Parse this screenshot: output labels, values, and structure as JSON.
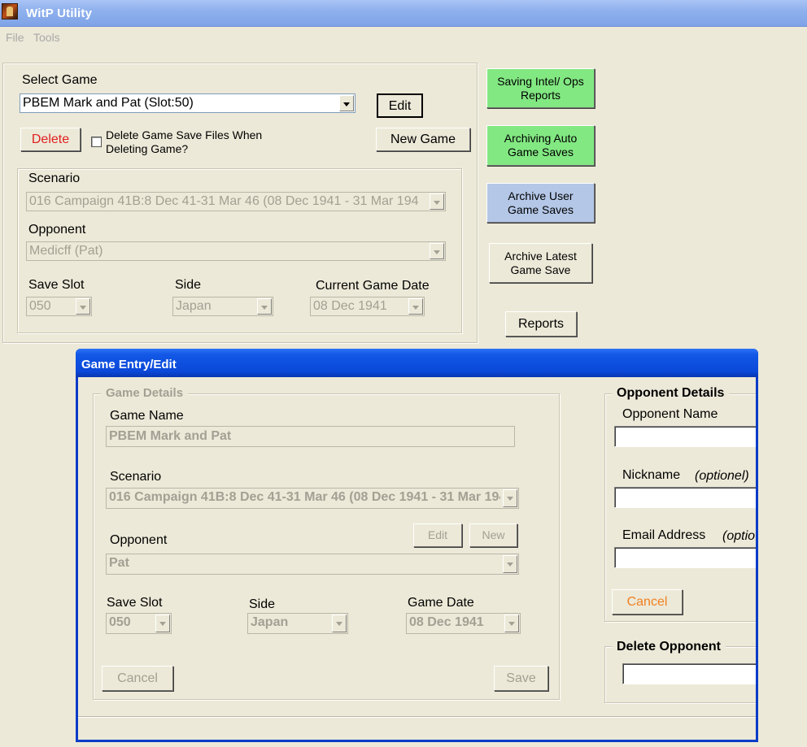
{
  "window": {
    "title": "WitP Utility"
  },
  "menu": {
    "file": "File",
    "tools": "Tools"
  },
  "main": {
    "select_game_label": "Select Game",
    "select_game_value": "PBEM Mark and Pat (Slot:50)",
    "edit_button": "Edit",
    "delete_button": "Delete",
    "delete_files_checkbox_label_line1": "Delete Game Save Files When",
    "delete_files_checkbox_label_line2": "Deleting Game?",
    "new_game_button": "New Game",
    "scenario_label": "Scenario",
    "scenario_value": "016 Campaign 41B:8 Dec 41-31 Mar 46 (08 Dec 1941 - 31 Mar 194",
    "opponent_label": "Opponent",
    "opponent_value": "Medicff (Pat)",
    "save_slot_label": "Save Slot",
    "save_slot_value": "050",
    "side_label": "Side",
    "side_value": "Japan",
    "current_date_label": "Current Game Date",
    "current_date_value": "08 Dec 1941"
  },
  "actions": {
    "saving_intel_line1": "Saving Intel/ Ops",
    "saving_intel_line2": "Reports",
    "archiving_auto_line1": "Archiving Auto",
    "archiving_auto_line2": "Game Saves",
    "archive_user_line1": "Archive User",
    "archive_user_line2": "Game Saves",
    "archive_latest_line1": "Archive Latest",
    "archive_latest_line2": "Game Save",
    "reports": "Reports"
  },
  "dialog": {
    "title": "Game Entry/Edit",
    "game_details_legend": "Game Details",
    "game_name_label": "Game Name",
    "game_name_value": "PBEM Mark and Pat",
    "scenario_label": "Scenario",
    "scenario_value": "016 Campaign 41B:8 Dec 41-31 Mar 46 (08 Dec 1941 - 31 Mar 194",
    "opponent_label": "Opponent",
    "opponent_edit": "Edit",
    "opponent_new": "New",
    "opponent_value": "Pat",
    "save_slot_label": "Save Slot",
    "save_slot_value": "050",
    "side_label": "Side",
    "side_value": "Japan",
    "game_date_label": "Game Date",
    "game_date_value": "08 Dec 1941",
    "cancel_button": "Cancel",
    "save_button": "Save",
    "opponent_details_legend": "Opponent Details",
    "opponent_name_label": "Opponent Name",
    "nickname_label": "Nickname",
    "nickname_optional": "(optionel)",
    "email_label": "Email Address",
    "email_optional": "(optio",
    "opp_cancel_button": "Cancel",
    "delete_opponent_legend": "Delete Opponent"
  }
}
